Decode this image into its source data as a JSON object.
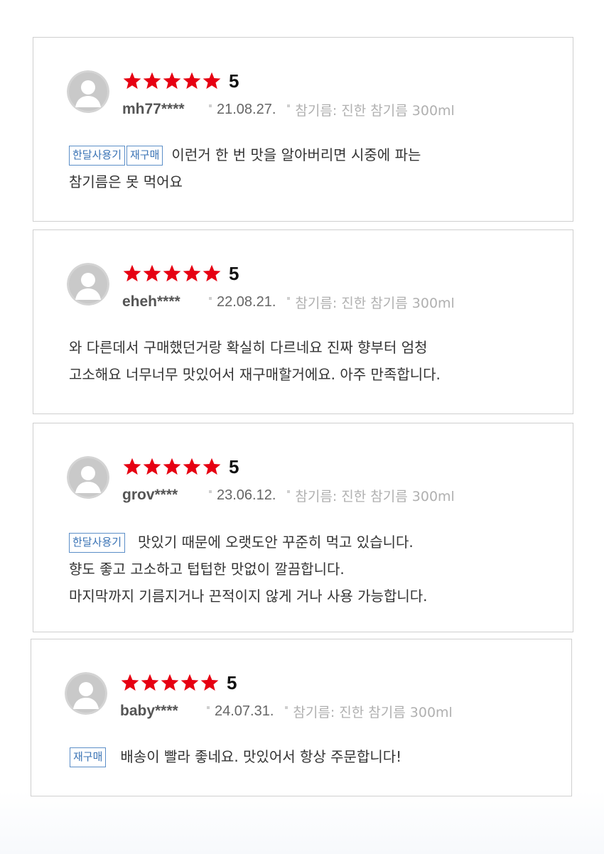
{
  "reviews": [
    {
      "score": "5",
      "stars": 5,
      "user": "mh77****",
      "date": "21.08.27.",
      "option": "참기름: 진한 참기름 300ml",
      "tags": [
        "한달사용기",
        "재구매"
      ],
      "lines": [
        "이런거 한 번 맛을 알아버리면 시중에 파는",
        "참기름은 못 먹어요"
      ]
    },
    {
      "score": "5",
      "stars": 5,
      "user": "eheh****",
      "date": "22.08.21.",
      "option": "참기름: 진한 참기름 300ml",
      "tags": [],
      "lines": [
        "와 다른데서 구매했던거랑 확실히 다르네요 진짜 향부터 엄청",
        "고소해요 너무너무 맛있어서 재구매할거에요. 아주 만족합니다."
      ]
    },
    {
      "score": "5",
      "stars": 5,
      "user": "grov****",
      "date": "23.06.12.",
      "option": "참기름: 진한 참기름 300ml",
      "tags": [
        "한달사용기"
      ],
      "lines": [
        "맛있기 때문에 오랫도안 꾸준히 먹고 있습니다.",
        "향도 좋고 고소하고 텁텁한 맛없이 깔끔합니다.",
        "마지막까지 기름지거나 끈적이지 않게 거나 사용 가능합니다."
      ]
    },
    {
      "score": "5",
      "stars": 5,
      "user": "baby****",
      "date": "24.07.31.",
      "option": "참기름: 진한 참기름 300ml",
      "tags": [
        "재구매"
      ],
      "lines": [
        "배송이 빨라 좋네요. 맛있어서 항상 주문합니다!"
      ]
    }
  ],
  "colors": {
    "star": "#e60012",
    "tag_border": "#5b8ec8",
    "card_border": "#cfcfcf"
  }
}
